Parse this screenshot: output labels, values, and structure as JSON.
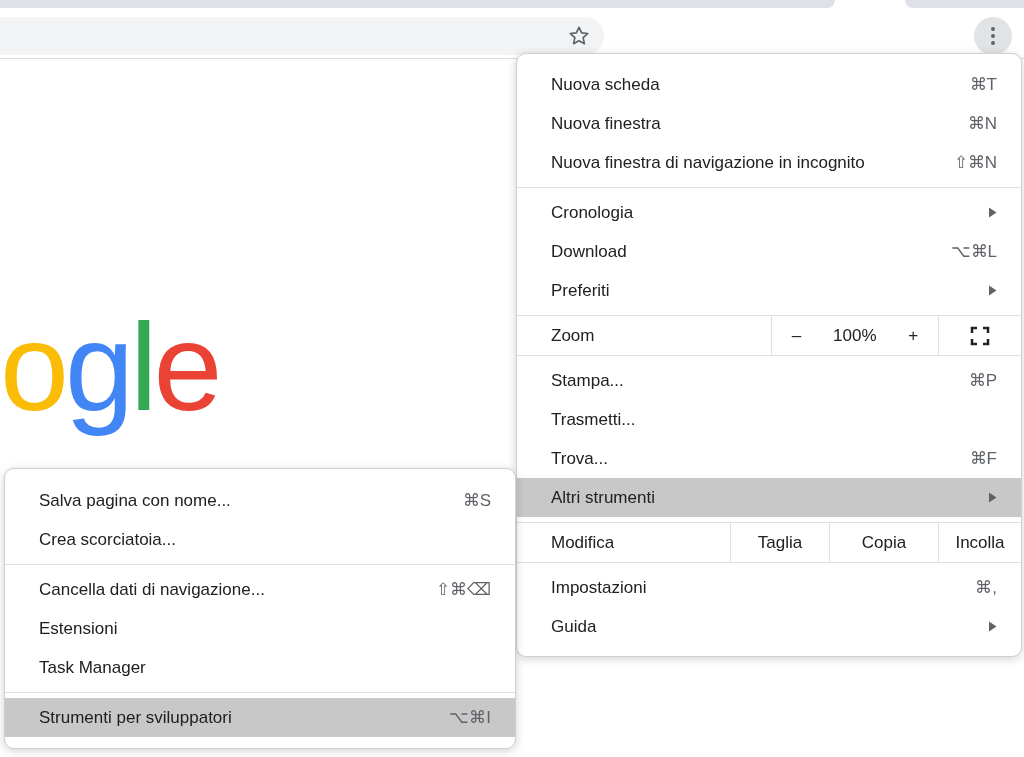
{
  "toolbar": {
    "bookmark_starred": false
  },
  "page": {
    "logo": [
      {
        "text": "o",
        "color": "#fbbc05"
      },
      {
        "text": "g",
        "color": "#4285f4"
      },
      {
        "text": "l",
        "color": "#34a853"
      },
      {
        "text": "e",
        "color": "#ea4335"
      }
    ]
  },
  "main_menu": [
    {
      "kind": "item",
      "label": "Nuova scheda",
      "shortcut": "⌘T",
      "has_submenu": false,
      "selected": false
    },
    {
      "kind": "item",
      "label": "Nuova finestra",
      "shortcut": "⌘N",
      "has_submenu": false,
      "selected": false
    },
    {
      "kind": "item",
      "label": "Nuova finestra di navigazione in incognito",
      "shortcut": "⇧⌘N",
      "has_submenu": false,
      "selected": false
    },
    {
      "kind": "separator"
    },
    {
      "kind": "item",
      "label": "Cronologia",
      "has_submenu": true,
      "selected": false
    },
    {
      "kind": "item",
      "label": "Download",
      "shortcut": "⌥⌘L",
      "has_submenu": false,
      "selected": false
    },
    {
      "kind": "item",
      "label": "Preferiti",
      "has_submenu": true,
      "selected": false
    },
    {
      "kind": "zoom",
      "label": "Zoom",
      "minus": "–",
      "value": "100%",
      "plus": "+"
    },
    {
      "kind": "item",
      "label": "Stampa...",
      "shortcut": "⌘P",
      "has_submenu": false,
      "selected": false
    },
    {
      "kind": "item",
      "label": "Trasmetti...",
      "has_submenu": false,
      "selected": false
    },
    {
      "kind": "item",
      "label": "Trova...",
      "shortcut": "⌘F",
      "has_submenu": false,
      "selected": false
    },
    {
      "kind": "item",
      "label": "Altri strumenti",
      "has_submenu": true,
      "selected": true
    },
    {
      "kind": "edit",
      "label": "Modifica",
      "buttons": [
        "Taglia",
        "Copia",
        "Incolla"
      ]
    },
    {
      "kind": "item",
      "label": "Impostazioni",
      "shortcut": "⌘,",
      "has_submenu": false,
      "selected": false
    },
    {
      "kind": "item",
      "label": "Guida",
      "has_submenu": true,
      "selected": false
    }
  ],
  "sub_menu": [
    {
      "kind": "item",
      "label": "Salva pagina con nome...",
      "shortcut": "⌘S",
      "has_submenu": false,
      "selected": false
    },
    {
      "kind": "item",
      "label": "Crea scorciatoia...",
      "has_submenu": false,
      "selected": false
    },
    {
      "kind": "separator"
    },
    {
      "kind": "item",
      "label": "Cancella dati di navigazione...",
      "shortcut": "⇧⌘⌫",
      "has_submenu": false,
      "selected": false
    },
    {
      "kind": "item",
      "label": "Estensioni",
      "has_submenu": false,
      "selected": false
    },
    {
      "kind": "item",
      "label": "Task Manager",
      "has_submenu": false,
      "selected": false
    },
    {
      "kind": "separator"
    },
    {
      "kind": "item",
      "label": "Strumenti per sviluppatori",
      "shortcut": "⌥⌘I",
      "has_submenu": false,
      "selected": true
    }
  ]
}
